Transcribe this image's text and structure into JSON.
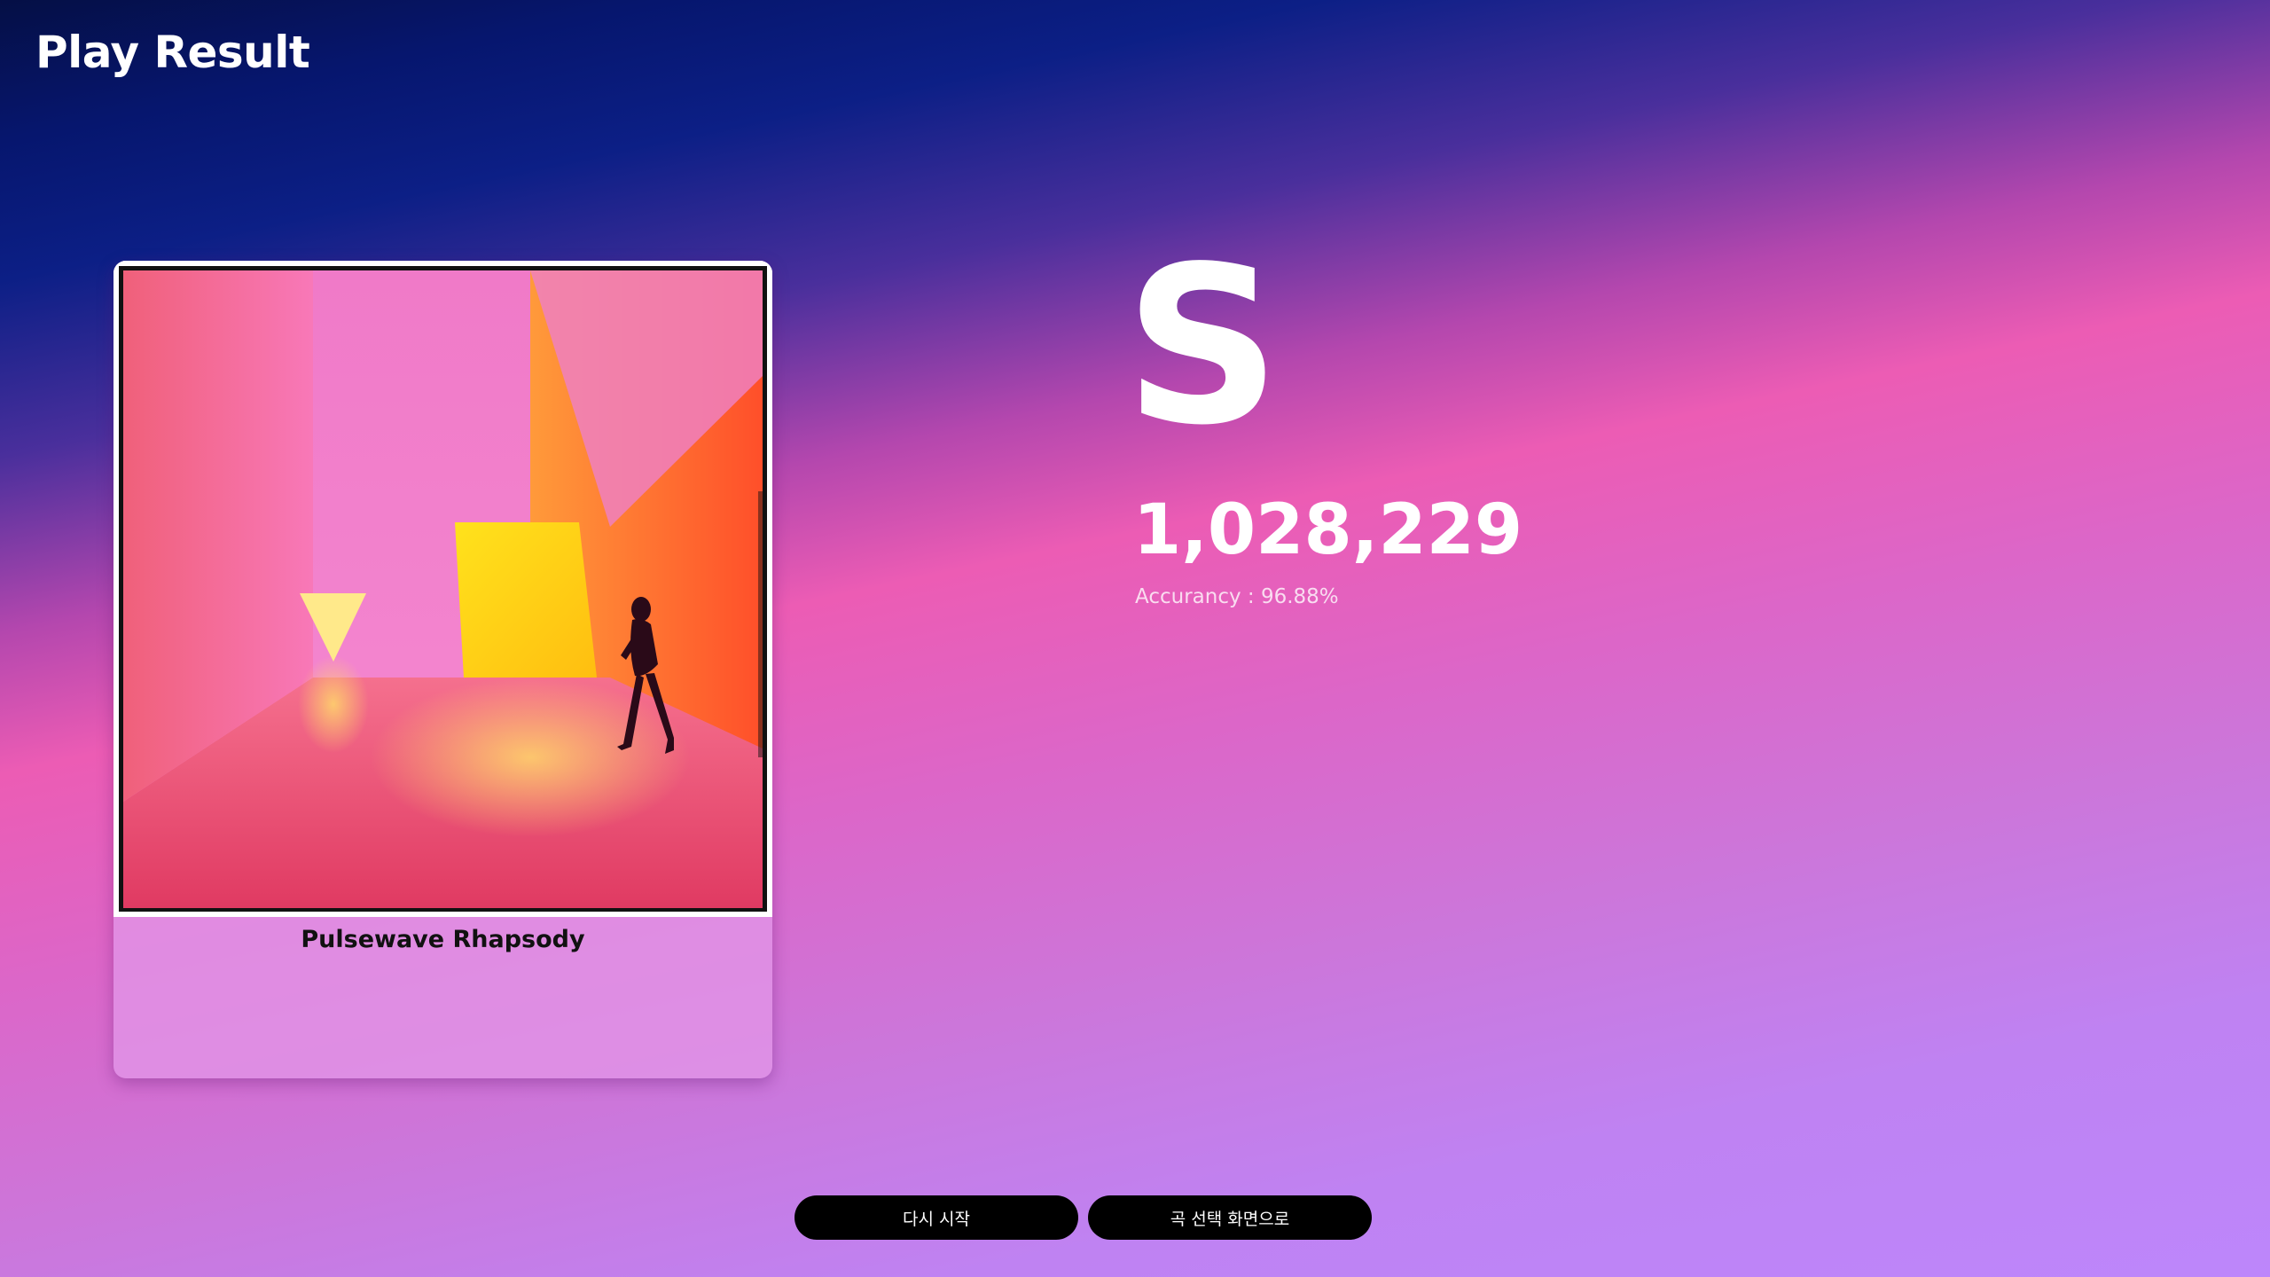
{
  "header": {
    "title": "Play Result"
  },
  "song": {
    "title": "Pulsewave Rhapsody",
    "album_art": "pink-orange-room-with-walking-woman"
  },
  "result": {
    "rank": "S",
    "score": "1,028,229",
    "accuracy": "Accurancy : 96.88%"
  },
  "actions": {
    "retry_label": "다시 시작",
    "song_select_label": "곡 선택 화면으로"
  },
  "colors": {
    "background_top": "#06166e",
    "background_mid": "#ec5cb4",
    "background_bottom": "#bd86fb",
    "button": "#000000"
  }
}
